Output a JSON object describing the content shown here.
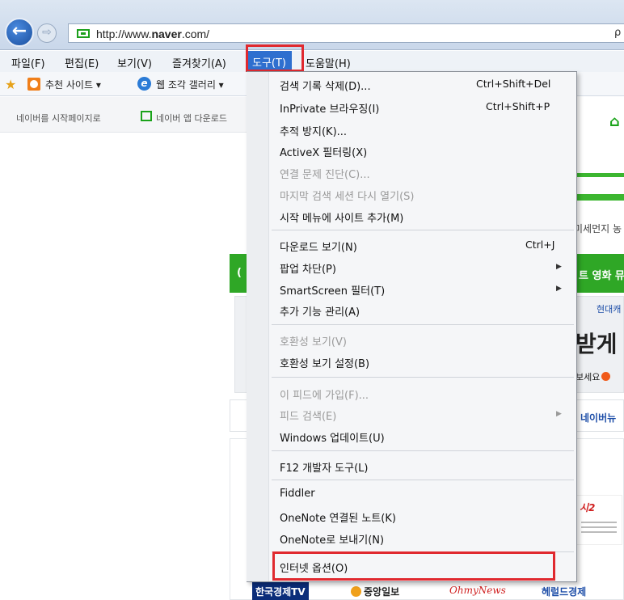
{
  "browser": {
    "url_prefix": "http://www.",
    "url_domain": "naver",
    "url_suffix": ".com/",
    "search_glyph": "ρ",
    "back_glyph": "←",
    "forward_glyph": "⇨"
  },
  "menubar": {
    "items": [
      "파일(F)",
      "편집(E)",
      "보기(V)",
      "즐겨찾기(A)",
      "도구(T)",
      "도움말(H)"
    ],
    "active_index": 4
  },
  "favorites_bar": {
    "recommended_sites": "추천 사이트 ▾",
    "web_slice_gallery": "웹 조각 갤러리 ▾"
  },
  "page": {
    "set_homepage": "네이버를 시작페이지로",
    "naver_app_download": "네이버 앱 다운로드",
    "dust_text": "미세먼지 농",
    "green_nav_left": "(",
    "green_nav_right": "트 영화 뮤",
    "ad_small": "현대캐",
    "ad_big": "받게",
    "ad_see": "보세요",
    "news_tab": "네이버뉴",
    "press_thumb_title": "시2",
    "press_logos": {
      "tv": "한국경제TV",
      "joongang": "중앙일보",
      "ohmynews": "OhmyNews",
      "herald": "헤럴드경제"
    }
  },
  "tools_menu": {
    "items": [
      {
        "label": "검색 기록 삭제(D)...",
        "shortcut": "Ctrl+Shift+Del"
      },
      {
        "label": "InPrivate 브라우징(I)",
        "shortcut": "Ctrl+Shift+P"
      },
      {
        "label": "추적 방지(K)..."
      },
      {
        "label": "ActiveX 필터링(X)"
      },
      {
        "label": "연결 문제 진단(C)...",
        "disabled": true
      },
      {
        "label": "마지막 검색 세션 다시 열기(S)",
        "disabled": true
      },
      {
        "label": "시작 메뉴에 사이트 추가(M)"
      },
      {
        "label": "다운로드 보기(N)",
        "shortcut": "Ctrl+J"
      },
      {
        "label": "팝업 차단(P)",
        "submenu": true
      },
      {
        "label": "SmartScreen 필터(T)",
        "submenu": true
      },
      {
        "label": "추가 기능 관리(A)"
      },
      {
        "label": "호환성 보기(V)",
        "disabled": true
      },
      {
        "label": "호환성 보기 설정(B)"
      },
      {
        "label": "이 피드에 가입(F)...",
        "disabled": true
      },
      {
        "label": "피드 검색(E)",
        "disabled": true,
        "submenu": true
      },
      {
        "label": "Windows 업데이트(U)"
      },
      {
        "label": "F12 개발자 도구(L)"
      },
      {
        "label": "Fiddler"
      },
      {
        "label": "OneNote 연결된 노트(K)"
      },
      {
        "label": "OneNote로 보내기(N)"
      },
      {
        "label": "인터넷 옵션(O)"
      }
    ],
    "submenu_glyph": "▶"
  },
  "colors": {
    "menu_highlight": "#2e6fcf",
    "annotation_red": "#e0292f",
    "naver_green": "#2fa726"
  }
}
